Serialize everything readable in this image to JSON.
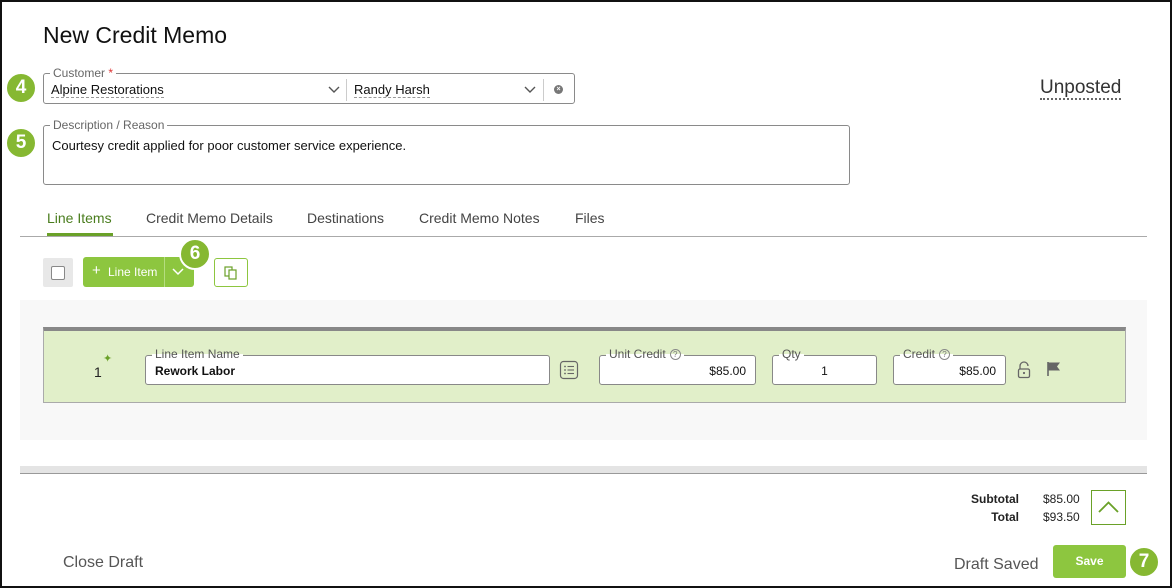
{
  "page": {
    "title": "New Credit Memo",
    "status": "Unposted"
  },
  "badges": {
    "customer": "4",
    "description": "5",
    "add_menu": "6",
    "save": "7"
  },
  "customer": {
    "label": "Customer",
    "required_mark": "*",
    "company": "Alpine Restorations",
    "contact": "Randy Harsh"
  },
  "description": {
    "label": "Description / Reason",
    "value": "Courtesy credit applied for poor customer service experience."
  },
  "tabs": [
    {
      "label": "Line Items",
      "active": true
    },
    {
      "label": "Credit Memo Details"
    },
    {
      "label": "Destinations"
    },
    {
      "label": "Credit Memo Notes"
    },
    {
      "label": "Files"
    }
  ],
  "toolbar": {
    "add_label": "Line Item",
    "add_icon": "plus-icon",
    "menu_icon": "chevron-down-icon",
    "copy_icon": "copy-icon"
  },
  "line_items": [
    {
      "number": "1",
      "name_label": "Line Item Name",
      "name": "Rework Labor",
      "unit_credit_label": "Unit Credit",
      "unit_credit": "$85.00",
      "qty_label": "Qty",
      "qty": "1",
      "credit_label": "Credit",
      "credit": "$85.00"
    }
  ],
  "totals": {
    "subtotal_label": "Subtotal",
    "subtotal": "$85.00",
    "total_label": "Total",
    "total": "$93.50"
  },
  "footer": {
    "close_label": "Close Draft",
    "saved_label": "Draft Saved",
    "save_label": "Save"
  },
  "colors": {
    "accent": "#8dc63f",
    "row_bg": "#e1efc9",
    "badge": "#86b832"
  }
}
